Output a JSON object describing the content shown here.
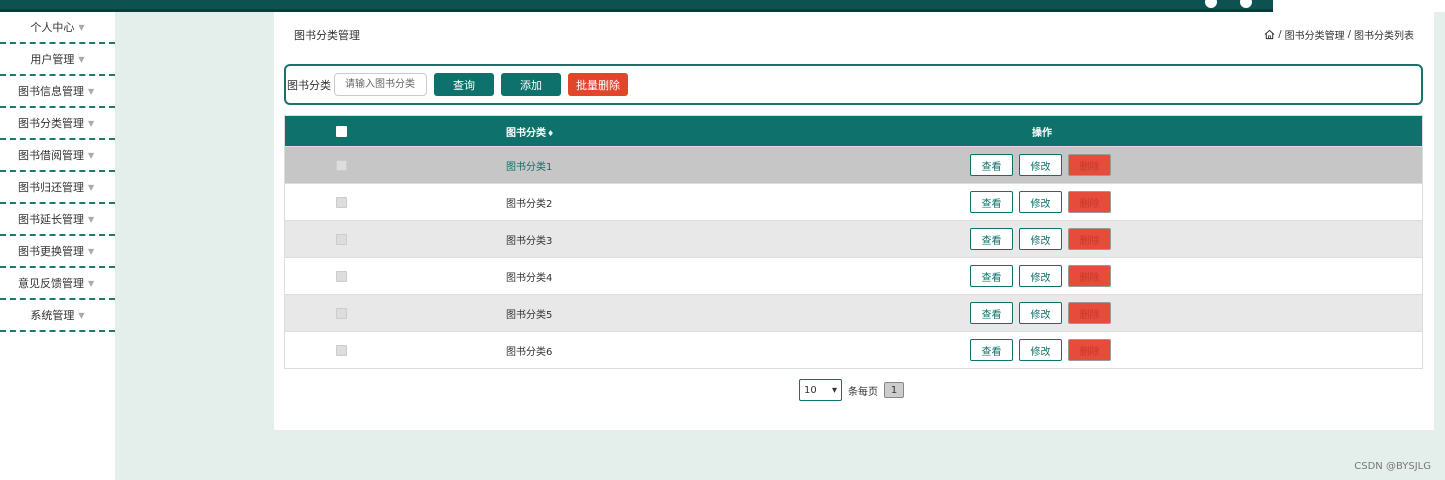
{
  "sidebar": {
    "items": [
      {
        "label": "个人中心"
      },
      {
        "label": "用户管理"
      },
      {
        "label": "图书信息管理"
      },
      {
        "label": "图书分类管理"
      },
      {
        "label": "图书借阅管理"
      },
      {
        "label": "图书归还管理"
      },
      {
        "label": "图书延长管理"
      },
      {
        "label": "图书更换管理"
      },
      {
        "label": "意见反馈管理"
      },
      {
        "label": "系统管理"
      }
    ],
    "caret": "▼"
  },
  "header": {
    "title": "图书分类管理",
    "breadcrumb": {
      "sep1": "/",
      "crumb1": "图书分类管理",
      "sep2": "/",
      "crumb2": "图书分类列表"
    }
  },
  "search": {
    "label": "图书分类",
    "placeholder": "请输入图书分类",
    "query_label": "查询",
    "add_label": "添加",
    "batch_delete_label": "批量删除"
  },
  "table": {
    "columns": {
      "name": "图书分类",
      "sort_icon": "♦",
      "ops": "操作"
    },
    "rows": [
      {
        "name": "图书分类1"
      },
      {
        "name": "图书分类2"
      },
      {
        "name": "图书分类3"
      },
      {
        "name": "图书分类4"
      },
      {
        "name": "图书分类5"
      },
      {
        "name": "图书分类6"
      }
    ],
    "ops": {
      "view": "查看",
      "edit": "修改",
      "delete": "删除"
    }
  },
  "pagination": {
    "per_page": "10",
    "per_page_label": "条每页",
    "current_page": "1"
  },
  "watermark": "CSDN @BYSJLG",
  "colors": {
    "accent": "#0e716b",
    "danger": "#e0462a",
    "background": "#e4efec"
  }
}
